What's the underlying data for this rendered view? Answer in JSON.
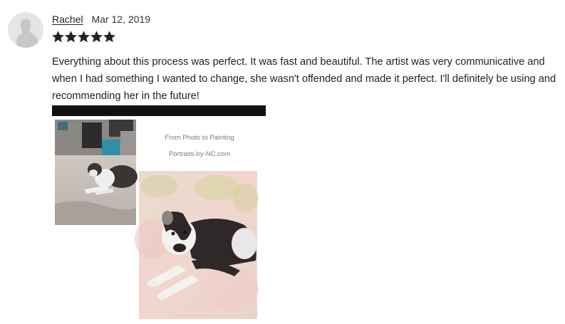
{
  "review": {
    "reviewer_name": "Rachel",
    "date": "Mar 12, 2019",
    "rating": 5,
    "rating_max": 5,
    "text": "Everything about this process was perfect. It was fast and beautiful. The artist was very communicative and when I had something I wanted to change, she wasn't offended and made it perfect. I'll definitely be using and recommending her in the future!"
  },
  "image": {
    "caption_title": "From Photo to Painting",
    "caption_site": "Portraits-by-NC.com"
  },
  "colors": {
    "star": "#222222",
    "redaction": "#111111",
    "avatar_bg": "#e5e5e5",
    "avatar_silhouette": "#c8c8c8"
  }
}
